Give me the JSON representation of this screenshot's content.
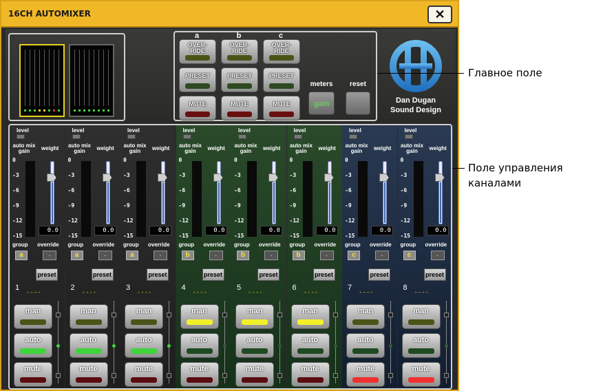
{
  "window": {
    "title": "16CH AUTOMIXER"
  },
  "master": {
    "columns": [
      {
        "letter": "a",
        "override": "OVER-\nRIDE",
        "preset": "PRESET",
        "mute": "MUTE"
      },
      {
        "letter": "b",
        "override": "OVER-\nRIDE",
        "preset": "PRESET",
        "mute": "MUTE"
      },
      {
        "letter": "c",
        "override": "OVER-\nRIDE",
        "preset": "PRESET",
        "mute": "MUTE"
      }
    ],
    "meters_label": "meters",
    "reset_label": "reset",
    "gain_label": "gain"
  },
  "logo": {
    "line1": "Dan Dugan",
    "line2": "Sound Design"
  },
  "strip_labels": {
    "level": "level",
    "auto_mix_gain": "auto mix gain",
    "weight": "weight",
    "group": "group",
    "override": "override",
    "preset": "preset",
    "man": "man",
    "auto": "auto",
    "mute": "mute",
    "scale": [
      "0",
      "-3",
      "-6",
      "-9",
      "-12",
      "-15"
    ],
    "override_value": "-",
    "preset_placeholder": "----"
  },
  "channels": [
    {
      "num": "1",
      "group": "a",
      "weight": "0.0",
      "theme": "gray",
      "man_on": false,
      "auto_on": true,
      "mute_on": false
    },
    {
      "num": "2",
      "group": "a",
      "weight": "0.0",
      "theme": "gray",
      "man_on": false,
      "auto_on": true,
      "mute_on": false
    },
    {
      "num": "3",
      "group": "a",
      "weight": "0.0",
      "theme": "gray",
      "man_on": false,
      "auto_on": true,
      "mute_on": false
    },
    {
      "num": "4",
      "group": "b",
      "weight": "0.0",
      "theme": "green",
      "man_on": true,
      "auto_on": false,
      "mute_on": false
    },
    {
      "num": "5",
      "group": "b",
      "weight": "0.0",
      "theme": "green",
      "man_on": true,
      "auto_on": false,
      "mute_on": false
    },
    {
      "num": "6",
      "group": "b",
      "weight": "0.0",
      "theme": "green",
      "man_on": true,
      "auto_on": false,
      "mute_on": false
    },
    {
      "num": "7",
      "group": "c",
      "weight": "0.0",
      "theme": "blue",
      "man_on": false,
      "auto_on": false,
      "mute_on": true
    },
    {
      "num": "8",
      "group": "c",
      "weight": "0.0",
      "theme": "blue",
      "man_on": false,
      "auto_on": false,
      "mute_on": true
    }
  ],
  "callouts": {
    "master": "Главное поле",
    "channels": "Поле управления\nканалами"
  },
  "colors": {
    "title_bar": "#f0b827",
    "group_a": "gray",
    "group_b": "green",
    "group_c": "blue"
  }
}
